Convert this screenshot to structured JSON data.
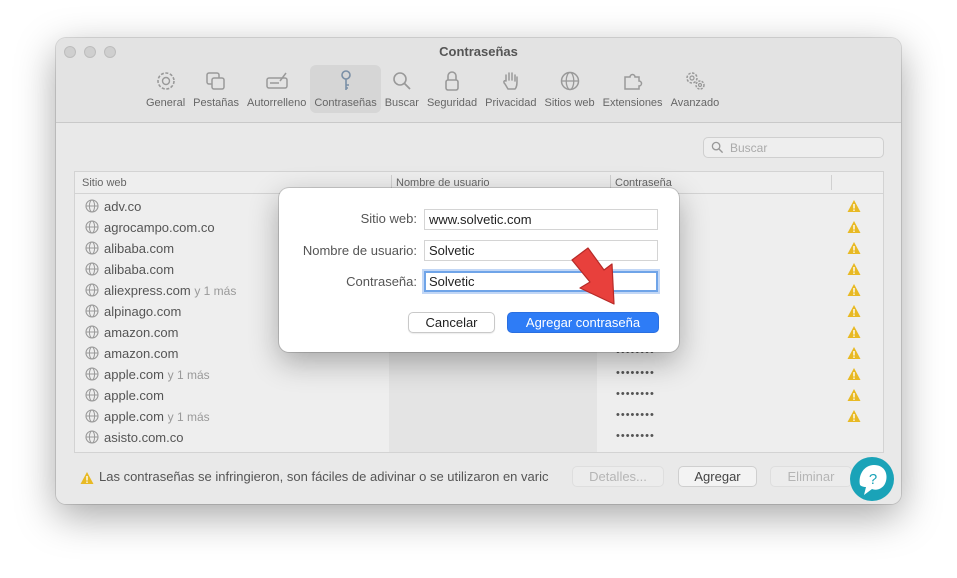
{
  "window": {
    "title": "Contraseñas"
  },
  "toolbar": {
    "items": [
      {
        "label": "General",
        "icon": "gear-icon"
      },
      {
        "label": "Pestañas",
        "icon": "tabs-icon"
      },
      {
        "label": "Autorrelleno",
        "icon": "autofill-icon"
      },
      {
        "label": "Contraseñas",
        "icon": "key-icon"
      },
      {
        "label": "Buscar",
        "icon": "search-icon"
      },
      {
        "label": "Seguridad",
        "icon": "lock-icon"
      },
      {
        "label": "Privacidad",
        "icon": "hand-icon"
      },
      {
        "label": "Sitios web",
        "icon": "globe-icon"
      },
      {
        "label": "Extensiones",
        "icon": "puzzle-icon"
      },
      {
        "label": "Avanzado",
        "icon": "gears-icon"
      }
    ],
    "active": "Contraseñas"
  },
  "search": {
    "placeholder": "Buscar"
  },
  "table": {
    "headers": {
      "site": "Sitio web",
      "user": "Nombre de usuario",
      "password": "Contraseña"
    },
    "rows": [
      {
        "site": "adv.co",
        "more": "",
        "password": "",
        "warning": true
      },
      {
        "site": "agrocampo.com.co",
        "more": "",
        "password": "",
        "warning": true
      },
      {
        "site": "alibaba.com",
        "more": "",
        "password": "",
        "warning": true
      },
      {
        "site": "alibaba.com",
        "more": "",
        "password": "",
        "warning": true
      },
      {
        "site": "aliexpress.com",
        "more": "y 1 más",
        "password": "",
        "warning": true
      },
      {
        "site": "alpinago.com",
        "more": "",
        "password": "",
        "warning": true
      },
      {
        "site": "amazon.com",
        "more": "",
        "password": "",
        "warning": true
      },
      {
        "site": "amazon.com",
        "more": "",
        "password": "••••••••",
        "warning": true
      },
      {
        "site": "apple.com",
        "more": "y 1 más",
        "password": "••••••••",
        "warning": true
      },
      {
        "site": "apple.com",
        "more": "",
        "password": "••••••••",
        "warning": true
      },
      {
        "site": "apple.com",
        "more": "y 1 más",
        "password": "••••••••",
        "warning": true
      },
      {
        "site": "asisto.com.co",
        "more": "",
        "password": "••••••••",
        "warning": false
      }
    ]
  },
  "footer": {
    "warning_text": "Las contraseñas se infringieron, son fáciles de adivinar o se utilizaron en varic",
    "details_label": "Detalles...",
    "add_label": "Agregar",
    "remove_label": "Eliminar"
  },
  "dialog": {
    "site_label": "Sitio web:",
    "site_value": "www.solvetic.com",
    "user_label": "Nombre de usuario:",
    "user_value": "Solvetic",
    "password_label": "Contraseña:",
    "password_value": "Solvetic",
    "cancel_label": "Cancelar",
    "add_label": "Agregar contraseña"
  },
  "colors": {
    "accent": "#2e7cf6",
    "warning": "#e8b923",
    "arrow": "#e8403c",
    "logo": "#1aa3b8"
  }
}
